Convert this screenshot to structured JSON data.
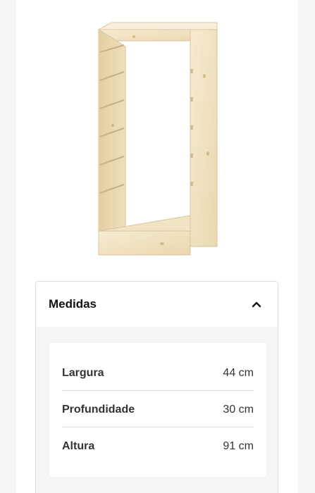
{
  "product": {
    "image_icon": "pine-frame-shelf-image"
  },
  "measures": {
    "title": "Medidas",
    "expanded_icon": "chevron-up-icon",
    "rows": [
      {
        "label": "Largura",
        "value": "44 cm"
      },
      {
        "label": "Profundidade",
        "value": "30 cm"
      },
      {
        "label": "Altura",
        "value": "91 cm"
      }
    ]
  },
  "colors": {
    "page_background": "#f5f5f5",
    "card": "#ffffff",
    "wood_light": "#f3e6c9",
    "wood_mid": "#e6d2a8",
    "text": "#333333",
    "divider": "#dcdcdc"
  }
}
